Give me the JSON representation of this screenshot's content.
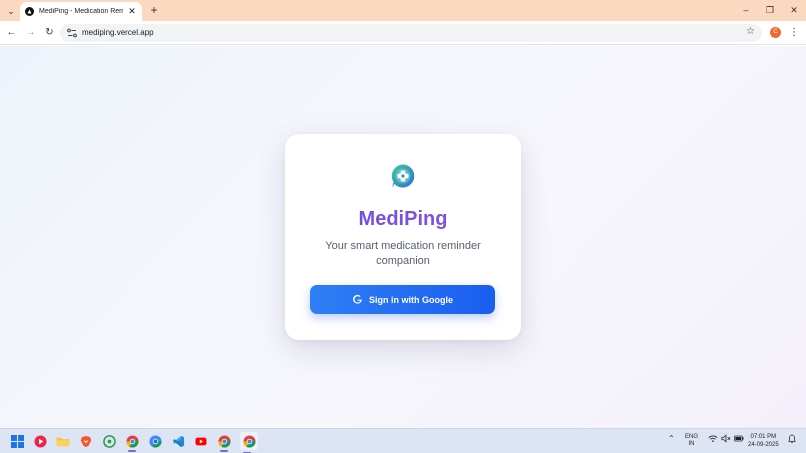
{
  "browser": {
    "tab_title": "MediPing - Medication Reminder",
    "tab_search_icon": "chevron-down-icon",
    "new_tab_label": "+",
    "url": "mediping.vercel.app",
    "profile_initial": "C",
    "window_controls": {
      "minimize": "–",
      "maximize": "❐",
      "close": "✕"
    }
  },
  "card": {
    "app_name": "MediPing",
    "tagline": "Your smart medication reminder companion",
    "signin_label": "Sign in with Google"
  },
  "taskbar": {
    "apps": [
      "windows-start",
      "media-player",
      "file-explorer",
      "brave-browser",
      "whatsapp",
      "chrome",
      "chrome",
      "vscode",
      "youtube",
      "chrome",
      "chrome"
    ],
    "lang_line1": "ENG",
    "lang_line2": "IN",
    "time": "07:01 PM",
    "date": "24-09-2025"
  },
  "colors": {
    "brand_purple": "#7b4fe0",
    "button_blue": "#1a5df0",
    "tab_strip": "#fbd9c1"
  }
}
